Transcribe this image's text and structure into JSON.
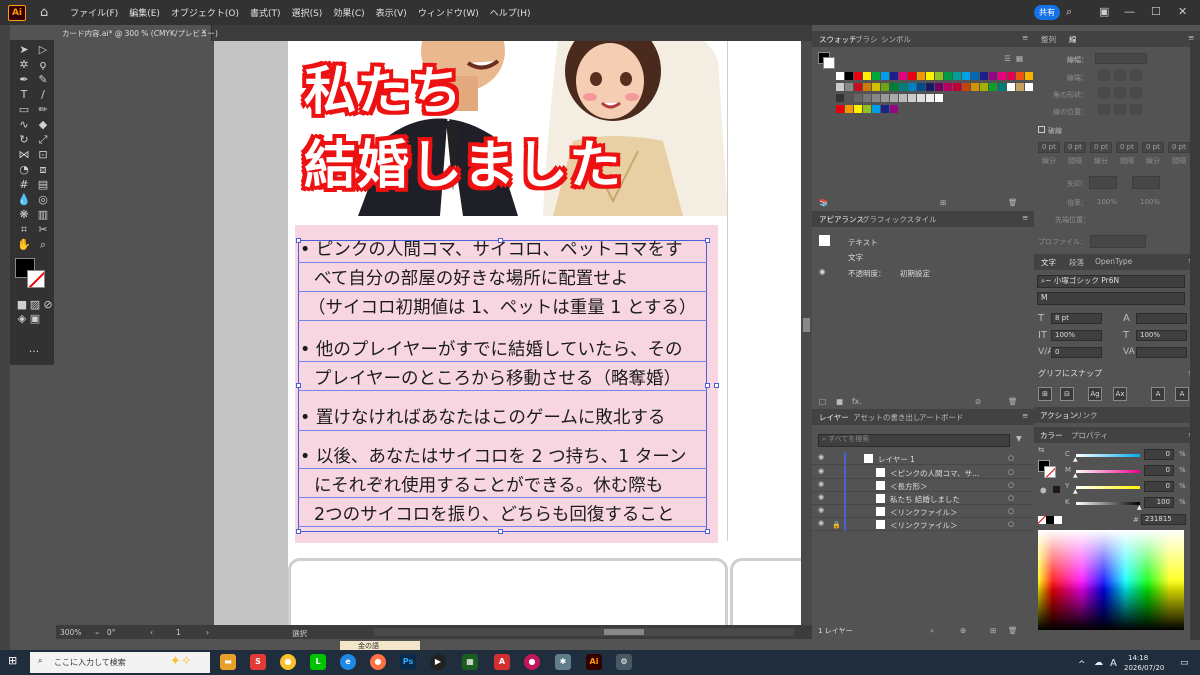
{
  "menubar": {
    "logo": "Ai",
    "items": [
      "ファイル(F)",
      "編集(E)",
      "オブジェクト(O)",
      "書式(T)",
      "選択(S)",
      "効果(C)",
      "表示(V)",
      "ウィンドウ(W)",
      "ヘルプ(H)"
    ],
    "share_label": "共有"
  },
  "document": {
    "tab_title": "カード内容.ai* @ 300 % (CMYK/プレビュー)",
    "close": "×"
  },
  "artboard": {
    "heading_line1": "私たち",
    "heading_line2": "結婚しました",
    "bullets": [
      {
        "lines": [
          "• ピンクの人間コマ、サイコロ、ペットコマをす",
          "べて自分の部屋の好きな場所に配置せよ",
          "（サイコロ初期値は 1、ペットは重量 1 とする）"
        ]
      },
      {
        "lines": [
          "• 他のプレイヤーがすでに結婚していたら、その",
          "プレイヤーのところから移動させる（略奪婚）"
        ]
      },
      {
        "lines": [
          "• 置けなければあなたはこのゲームに敗北する"
        ]
      },
      {
        "lines": [
          "• 以後、あなたはサイコロを 2 つ持ち、1 ターン",
          "にそれぞれ使用することができる。休む際も",
          "2つのサイコロを振り、どちらも回復すること"
        ]
      }
    ]
  },
  "statusbar": {
    "zoom": "300%",
    "rotation": "0°",
    "artboard_num": "1",
    "tool": "選択"
  },
  "swatches_panel": {
    "tabs": [
      "スウォッチ",
      "ブラシ",
      "シンボル"
    ]
  },
  "appearance_panel": {
    "tabs": [
      "アピアランス",
      "グラフィックスタイル"
    ],
    "rows": [
      "テキスト",
      "文字",
      "不透明度：",
      "初期設定"
    ]
  },
  "layers_panel": {
    "tabs": [
      "レイヤー",
      "アセットの書き出し",
      "アートボード"
    ],
    "search_placeholder": "すべてを検索",
    "layer_name": "レイヤー 1",
    "items": [
      "＜ピンクの人間コマ、サ...",
      "＜長方形＞",
      "私たち 結婚しました",
      "＜リンクファイル＞",
      "＜リンクファイル＞"
    ],
    "footer": "1 レイヤー"
  },
  "stroke_panel": {
    "tabs": [
      "整列",
      "線"
    ],
    "labels": [
      "線幅：",
      "線端：",
      "角の形状：",
      "線の位置："
    ],
    "dashed": "破線",
    "dash_values": [
      "0 pt",
      "0 pt",
      "0 pt",
      "0 pt",
      "0 pt",
      "0 pt"
    ],
    "dash_labels": [
      "線分",
      "間隔",
      "線分",
      "間隔",
      "線分",
      "間隔"
    ],
    "arrow": "矢印：",
    "scale": "倍率：",
    "scale_values": [
      "100%",
      "100%"
    ],
    "align": "先端位置：",
    "profile": "プロファイル："
  },
  "character_panel": {
    "tabs": [
      "文字",
      "段落",
      "OpenType"
    ],
    "font": "小塚ゴシック Pr6N",
    "style": "M",
    "size": "8 pt",
    "vscale": "100%",
    "hscale": "100%",
    "tracking": "0",
    "glyph_snap": "グリフにスナップ"
  },
  "color_panel": {
    "tabs_top": [
      "アクション",
      "リンク"
    ],
    "tabs": [
      "カラー",
      "プロパティ"
    ],
    "channels": [
      {
        "name": "C",
        "value": "0"
      },
      {
        "name": "M",
        "value": "0"
      },
      {
        "name": "Y",
        "value": "0"
      },
      {
        "name": "K",
        "value": "100"
      }
    ],
    "unit": "%",
    "hex": "231815"
  },
  "taskbar": {
    "search_placeholder": "ここに入力して検索",
    "time": "14:18",
    "date": "2026/07/20",
    "folder_label": "金の語"
  }
}
